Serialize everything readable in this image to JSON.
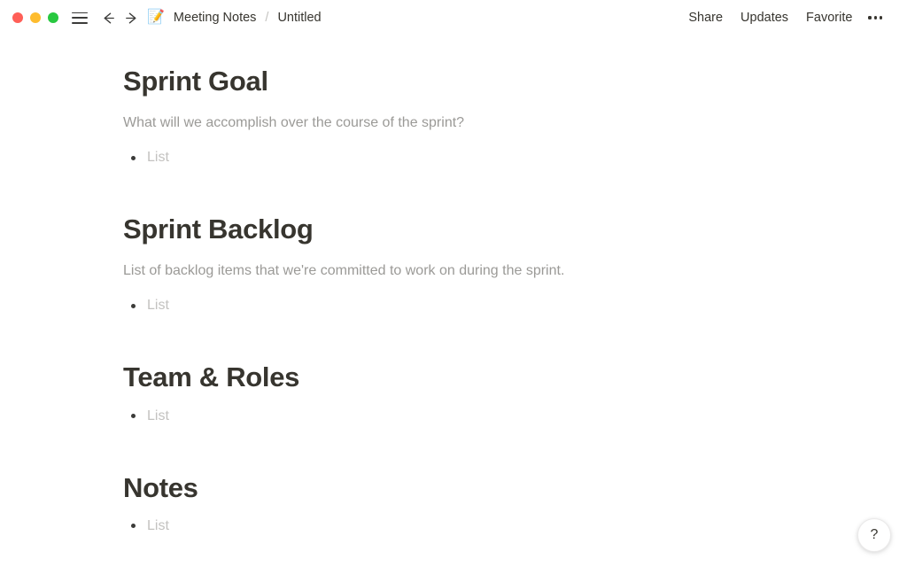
{
  "window": {
    "traffic_lights": [
      {
        "name": "close",
        "color": "#ff5f57"
      },
      {
        "name": "minimize",
        "color": "#febc2e"
      },
      {
        "name": "maximize",
        "color": "#28c840"
      }
    ]
  },
  "titlebar": {
    "sidebar_toggle_icon": "hamburger-icon",
    "back_icon": "arrow-left-icon",
    "forward_icon": "arrow-right-icon",
    "doc_emoji": "📝",
    "breadcrumb": {
      "parent": "Meeting Notes",
      "separator": "/",
      "current": "Untitled"
    },
    "actions": [
      {
        "label": "Share",
        "name": "share-button"
      },
      {
        "label": "Updates",
        "name": "updates-button"
      },
      {
        "label": "Favorite",
        "name": "favorite-button"
      }
    ],
    "more_label": "•••"
  },
  "document": {
    "sections": [
      {
        "heading": "Sprint Goal",
        "description": "What will we accomplish over the course of the sprint?",
        "bullet_placeholder": "List"
      },
      {
        "heading": "Sprint Backlog",
        "description": "List of backlog items that we're committed to work on during the sprint.",
        "bullet_placeholder": "List"
      },
      {
        "heading": "Team & Roles",
        "description": null,
        "bullet_placeholder": "List"
      },
      {
        "heading": "Notes",
        "description": null,
        "bullet_placeholder": "List"
      }
    ]
  },
  "help": {
    "label": "?"
  },
  "colors": {
    "text_primary": "#37352f",
    "text_muted": "#9b9a97",
    "placeholder": "#c3c2c0",
    "background": "#ffffff"
  }
}
